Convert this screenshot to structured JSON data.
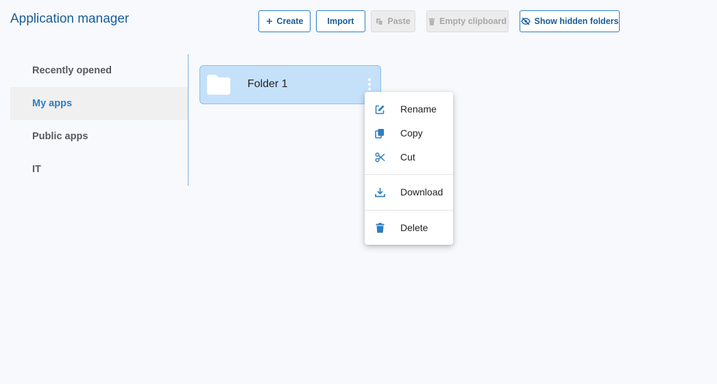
{
  "app": {
    "title": "Application manager"
  },
  "toolbar": {
    "create_label": "Create",
    "import_label": "Import",
    "paste_label": "Paste",
    "empty_clipboard_label": "Empty clipboard",
    "show_hidden_label": "Show hidden folders",
    "icons": {
      "create": "plus-icon",
      "paste": "paste-icon",
      "empty_clipboard": "trash-icon",
      "show_hidden": "eye-slash-icon"
    },
    "disabled": [
      "Paste",
      "Empty clipboard"
    ]
  },
  "sidebar": {
    "items": [
      {
        "label": "Recently opened",
        "selected": false
      },
      {
        "label": "My apps",
        "selected": true
      },
      {
        "label": "Public apps",
        "selected": false
      },
      {
        "label": "IT",
        "selected": false
      }
    ]
  },
  "folders": [
    {
      "name": "Folder 1",
      "icon": "folder-icon",
      "selected": true
    }
  ],
  "context_menu": {
    "items": [
      {
        "label": "Rename",
        "icon": "edit-icon"
      },
      {
        "label": "Copy",
        "icon": "copy-icon"
      },
      {
        "label": "Cut",
        "icon": "scissors-icon"
      },
      {
        "label": "Download",
        "icon": "download-icon"
      },
      {
        "label": "Delete",
        "icon": "trash-icon"
      }
    ]
  },
  "colors": {
    "accent": "#2e7dbf",
    "title": "#1a5c96",
    "folder_bg": "#c5e1fa",
    "page_bg": "#f7f9fc"
  }
}
